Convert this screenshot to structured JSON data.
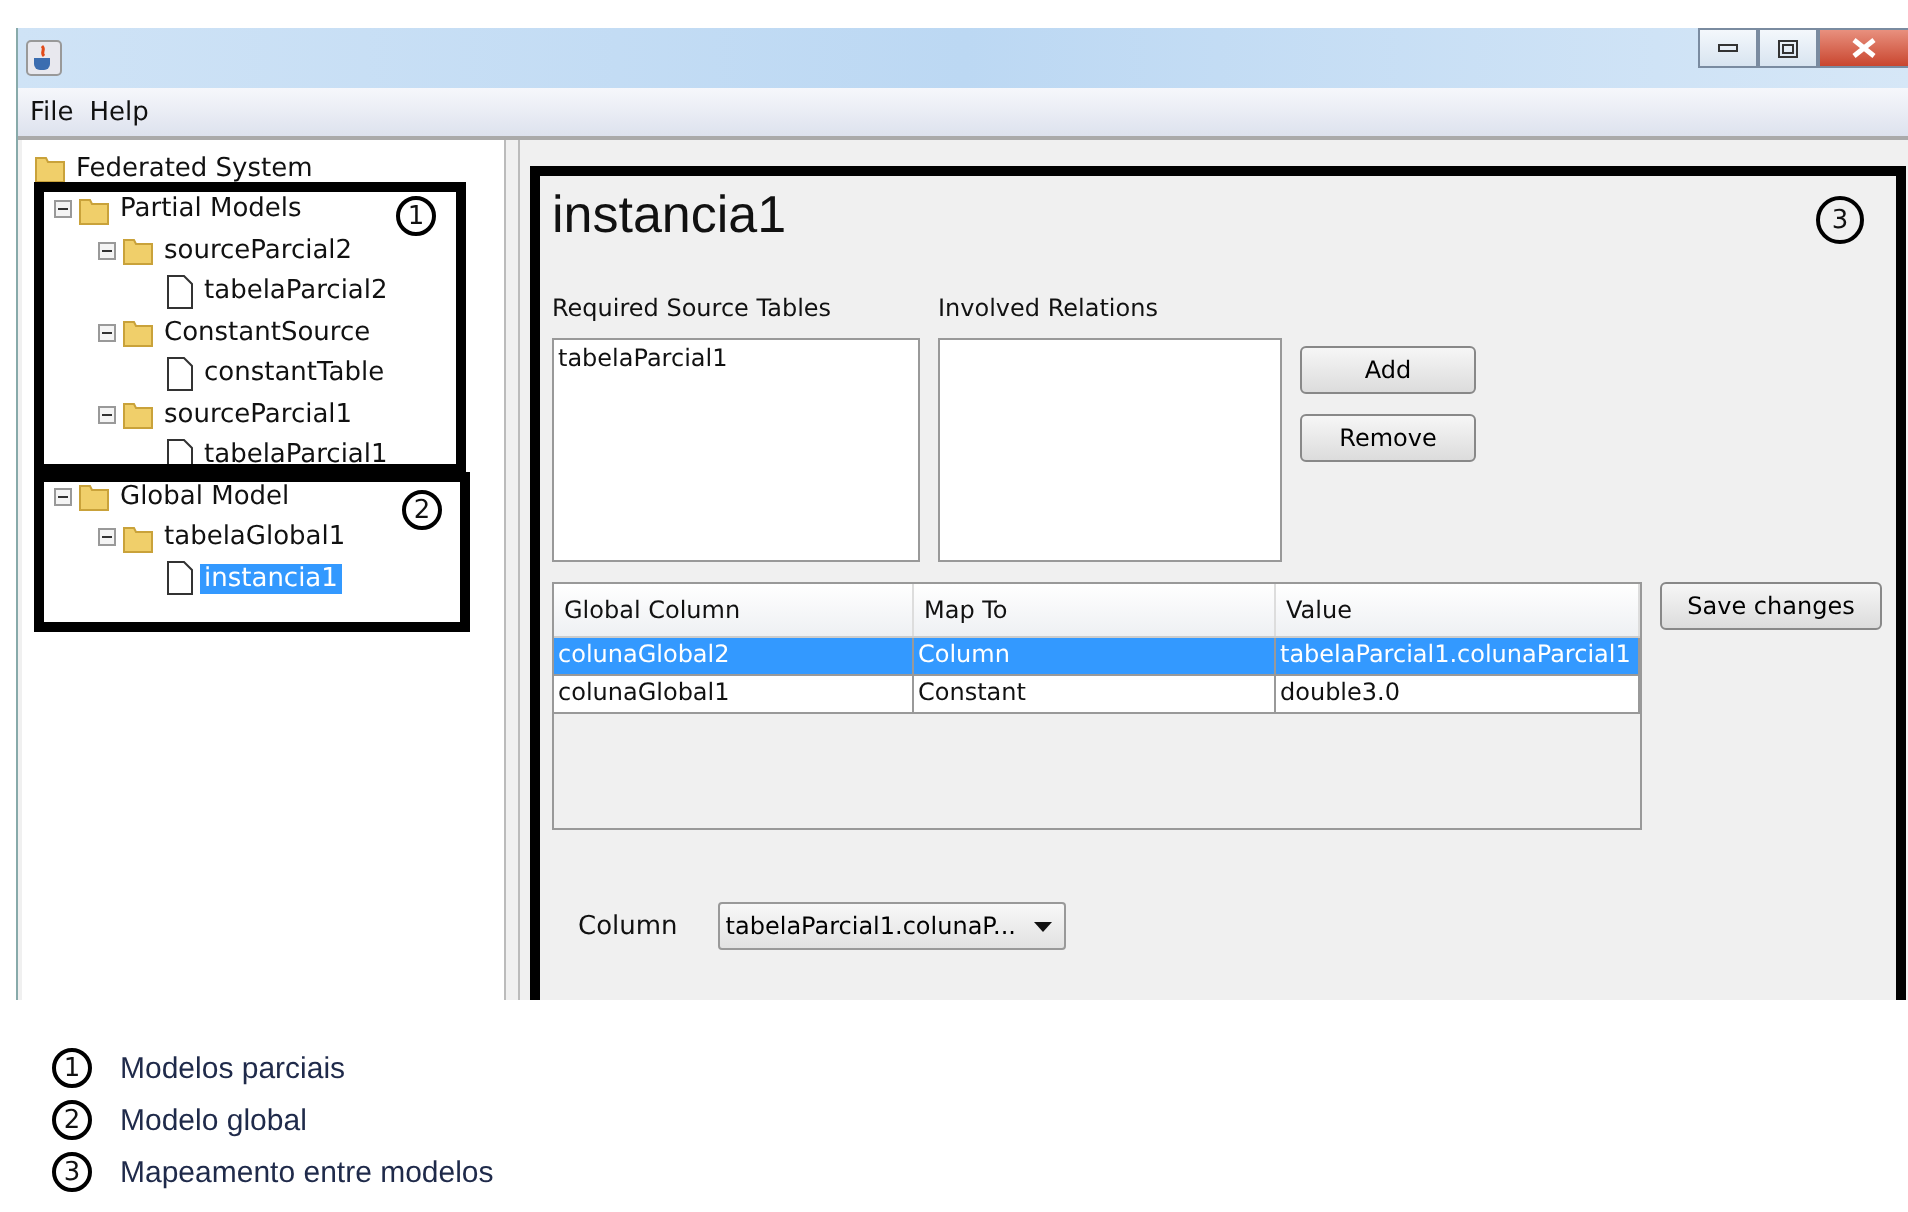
{
  "menu": [
    "File",
    "Help"
  ],
  "tree": {
    "label": "Federated System",
    "kind": "folder",
    "selected": false,
    "children": [
      {
        "label": "Partial Models",
        "kind": "folder",
        "expanded": true,
        "selected": false,
        "children": [
          {
            "label": "sourceParcial2",
            "kind": "folder",
            "expanded": true,
            "selected": false,
            "children": [
              {
                "label": "tabelaParcial2",
                "kind": "file",
                "selected": false
              }
            ]
          },
          {
            "label": "ConstantSource",
            "kind": "folder",
            "expanded": true,
            "selected": false,
            "children": [
              {
                "label": "constantTable",
                "kind": "file",
                "selected": false
              }
            ]
          },
          {
            "label": "sourceParcial1",
            "kind": "folder",
            "expanded": true,
            "selected": false,
            "children": [
              {
                "label": "tabelaParcial1",
                "kind": "file",
                "selected": false
              }
            ]
          }
        ]
      },
      {
        "label": "Global Model",
        "kind": "folder",
        "expanded": true,
        "selected": false,
        "children": [
          {
            "label": "tabelaGlobal1",
            "kind": "folder",
            "expanded": true,
            "selected": false,
            "children": [
              {
                "label": "instancia1",
                "kind": "file",
                "selected": true
              }
            ]
          }
        ]
      }
    ]
  },
  "detail": {
    "title": "instancia1",
    "required_source_tables": {
      "label": "Required Source Tables",
      "items": [
        "tabelaParcial1"
      ]
    },
    "involved_relations": {
      "label": "Involved Relations"
    },
    "buttons": [
      "Add",
      "Remove"
    ],
    "table": {
      "columns": [
        "Global Column",
        "Map To",
        "Value"
      ],
      "rows": [
        {
          "cells": [
            "colunaGlobal2",
            "Column",
            "tabelaParcial1.colunaParcial1"
          ],
          "selected": true
        },
        {
          "cells": [
            "colunaGlobal1",
            "Constant",
            "double3.0"
          ],
          "selected": false
        }
      ]
    },
    "save_button": "Save changes",
    "column_field": {
      "label": "Column",
      "value": "tabelaParcial1.colunaP..."
    }
  },
  "annotations": [
    "1",
    "2",
    "3"
  ],
  "legend": [
    {
      "number": "1",
      "text": "Modelos parciais"
    },
    {
      "number": "2",
      "text": "Modelo global"
    },
    {
      "number": "3",
      "text": "Mapeamento entre modelos"
    }
  ]
}
